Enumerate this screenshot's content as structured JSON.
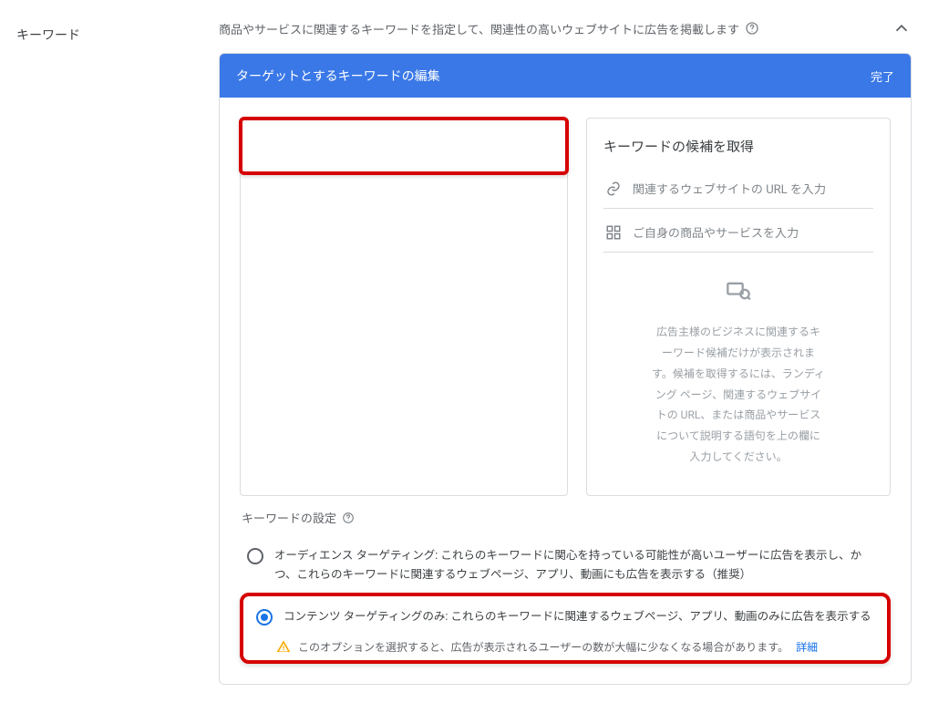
{
  "section": {
    "label": "キーワード",
    "description": "商品やサービスに関連するキーワードを指定して、関連性の高いウェブサイトに広告を掲載します"
  },
  "panel": {
    "title": "ターゲットとするキーワードの編集",
    "done": "完了"
  },
  "suggestions": {
    "title": "キーワードの候補を取得",
    "url_placeholder": "関連するウェブサイトの URL を入力",
    "product_placeholder": "ご自身の商品やサービスを入力",
    "empty_message": "広告主様のビジネスに関連するキーワード候補だけが表示されます。候補を取得するには、ランディング ページ、関連するウェブサイトの URL、または商品やサービスについて説明する語句を上の欄に入力してください。"
  },
  "keyword_settings": {
    "label": "キーワードの設定",
    "option_audience": "オーディエンス ターゲティング: これらのキーワードに関心を持っている可能性が高いユーザーに広告を表示し、かつ、これらのキーワードに関連するウェブページ、アプリ、動画にも広告を表示する（推奨）",
    "option_content": "コンテンツ ターゲティングのみ: これらのキーワードに関連するウェブページ、アプリ、動画のみに広告を表示する",
    "warning": "このオプションを選択すると、広告が表示されるユーザーの数が大幅に少なくなる場合があります。",
    "learn_more": "詳細"
  }
}
